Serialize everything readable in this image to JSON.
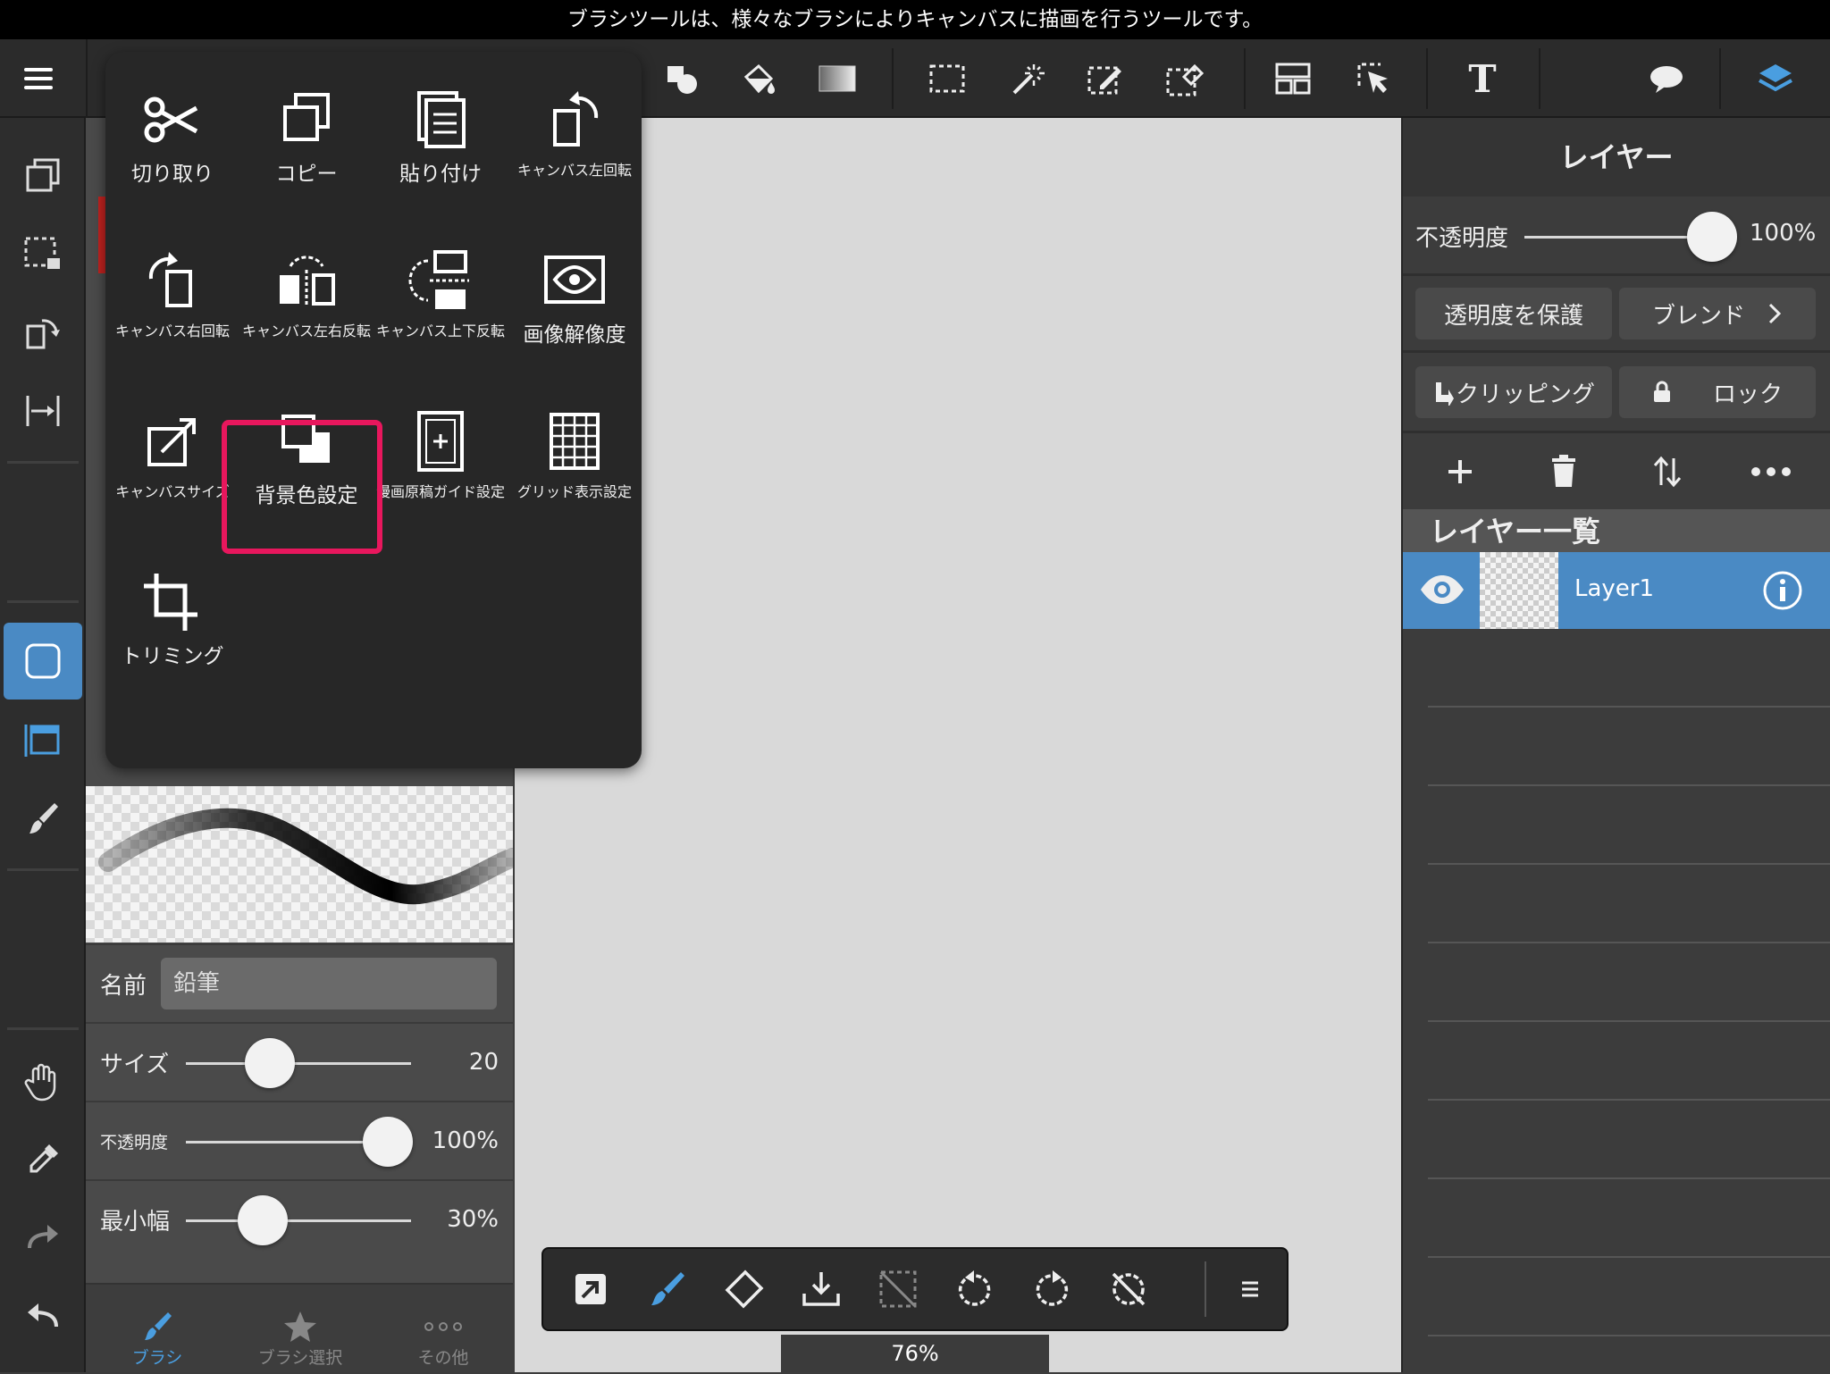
{
  "hint_bar": {
    "text": "ブラシツールは、様々なブラシによりキャンバスに描画を行うツールです。"
  },
  "toolbar": {
    "tools": [
      "menu-icon",
      "shapes-icon",
      "fill-icon",
      "gradient-icon",
      "rect-select-icon",
      "magic-wand-icon",
      "select-pen-icon",
      "select-eraser-icon",
      "layout-icon",
      "select-move-icon",
      "text-icon",
      "speech-bubble-icon",
      "layers-icon"
    ],
    "text_tool_glyph": "T"
  },
  "edit_menu": {
    "items": [
      {
        "label": "切り取り",
        "icon": "scissors-icon"
      },
      {
        "label": "コピー",
        "icon": "copy-icon"
      },
      {
        "label": "貼り付け",
        "icon": "paste-icon"
      },
      {
        "label": "キャンバス左回転",
        "icon": "rotate-left-icon"
      },
      {
        "label": "キャンバス右回転",
        "icon": "rotate-right-icon"
      },
      {
        "label": "キャンバス左右反転",
        "icon": "flip-horizontal-icon"
      },
      {
        "label": "キャンバス上下反転",
        "icon": "flip-vertical-icon"
      },
      {
        "label": "画像解像度",
        "icon": "eye-icon"
      },
      {
        "label": "キャンバスサイズ",
        "icon": "canvas-size-icon"
      },
      {
        "label": "背景色設定",
        "icon": "background-color-icon"
      },
      {
        "label": "漫画原稿ガイド設定",
        "icon": "manga-guide-icon"
      },
      {
        "label": "グリッド表示設定",
        "icon": "grid-icon"
      },
      {
        "label": "トリミング",
        "icon": "crop-icon"
      }
    ],
    "highlighted": "背景色設定"
  },
  "brush_panel": {
    "name_label": "名前",
    "name_value": "鉛筆",
    "size_label": "サイズ",
    "size_value": "20",
    "opacity_label": "不透明度",
    "opacity_value": "100%",
    "min_width_label": "最小幅",
    "min_width_value": "30%",
    "tabs": [
      {
        "label": "ブラシ",
        "icon": "brush-icon",
        "active": true
      },
      {
        "label": "ブラシ選択",
        "icon": "star-icon",
        "active": false
      },
      {
        "label": "その他",
        "icon": "more-icon",
        "active": false
      }
    ]
  },
  "layer_panel": {
    "title": "レイヤー",
    "opacity_label": "不透明度",
    "opacity_value": "100%",
    "protect_alpha": "透明度を保護",
    "blend": "ブレンド",
    "clipping": "クリッピング",
    "lock": "ロック",
    "list_title": "レイヤー一覧",
    "layers": [
      {
        "name": "Layer1",
        "visible": true,
        "selected": true
      }
    ]
  },
  "canvas": {
    "zoom": "76%"
  },
  "colors": {
    "accent": "#4a8ac4",
    "highlight": "#e8175d",
    "canvas": "#d9d9d9"
  }
}
